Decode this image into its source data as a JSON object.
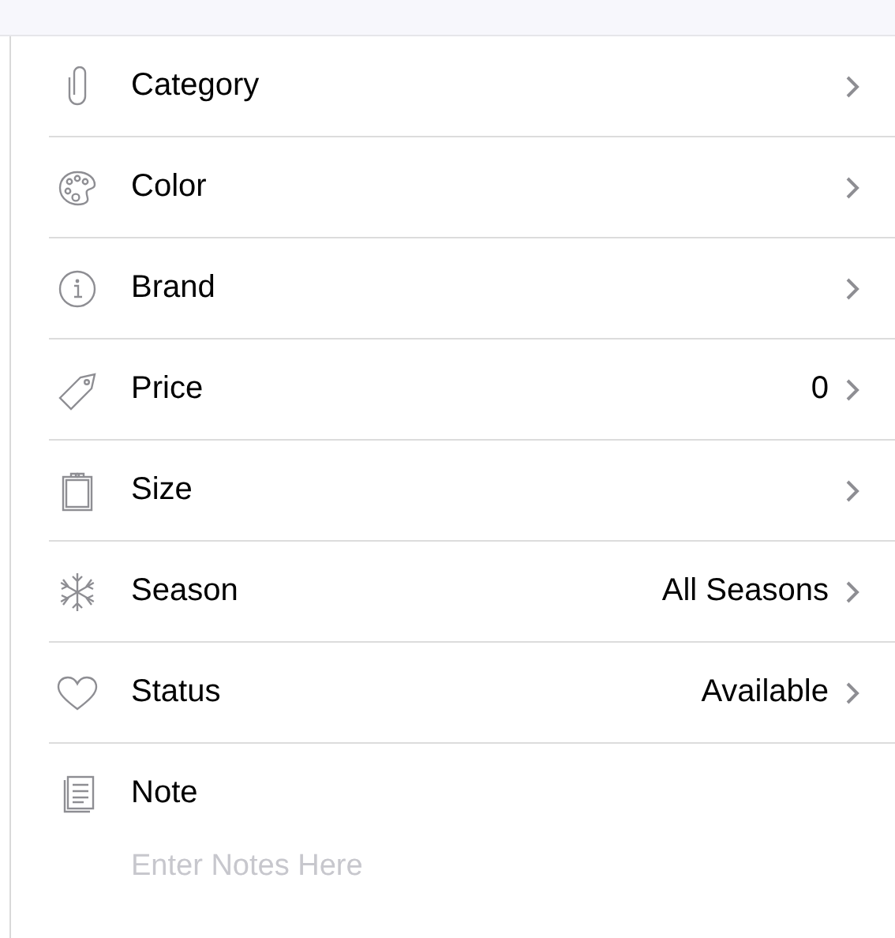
{
  "rows": [
    {
      "label": "Category"
    },
    {
      "label": "Color"
    },
    {
      "label": "Brand"
    },
    {
      "label": "Price",
      "value": "0"
    },
    {
      "label": "Size"
    },
    {
      "label": "Season",
      "value": "All Seasons"
    },
    {
      "label": "Status",
      "value": "Available"
    }
  ],
  "note": {
    "label": "Note",
    "placeholder": "Enter Notes Here"
  }
}
